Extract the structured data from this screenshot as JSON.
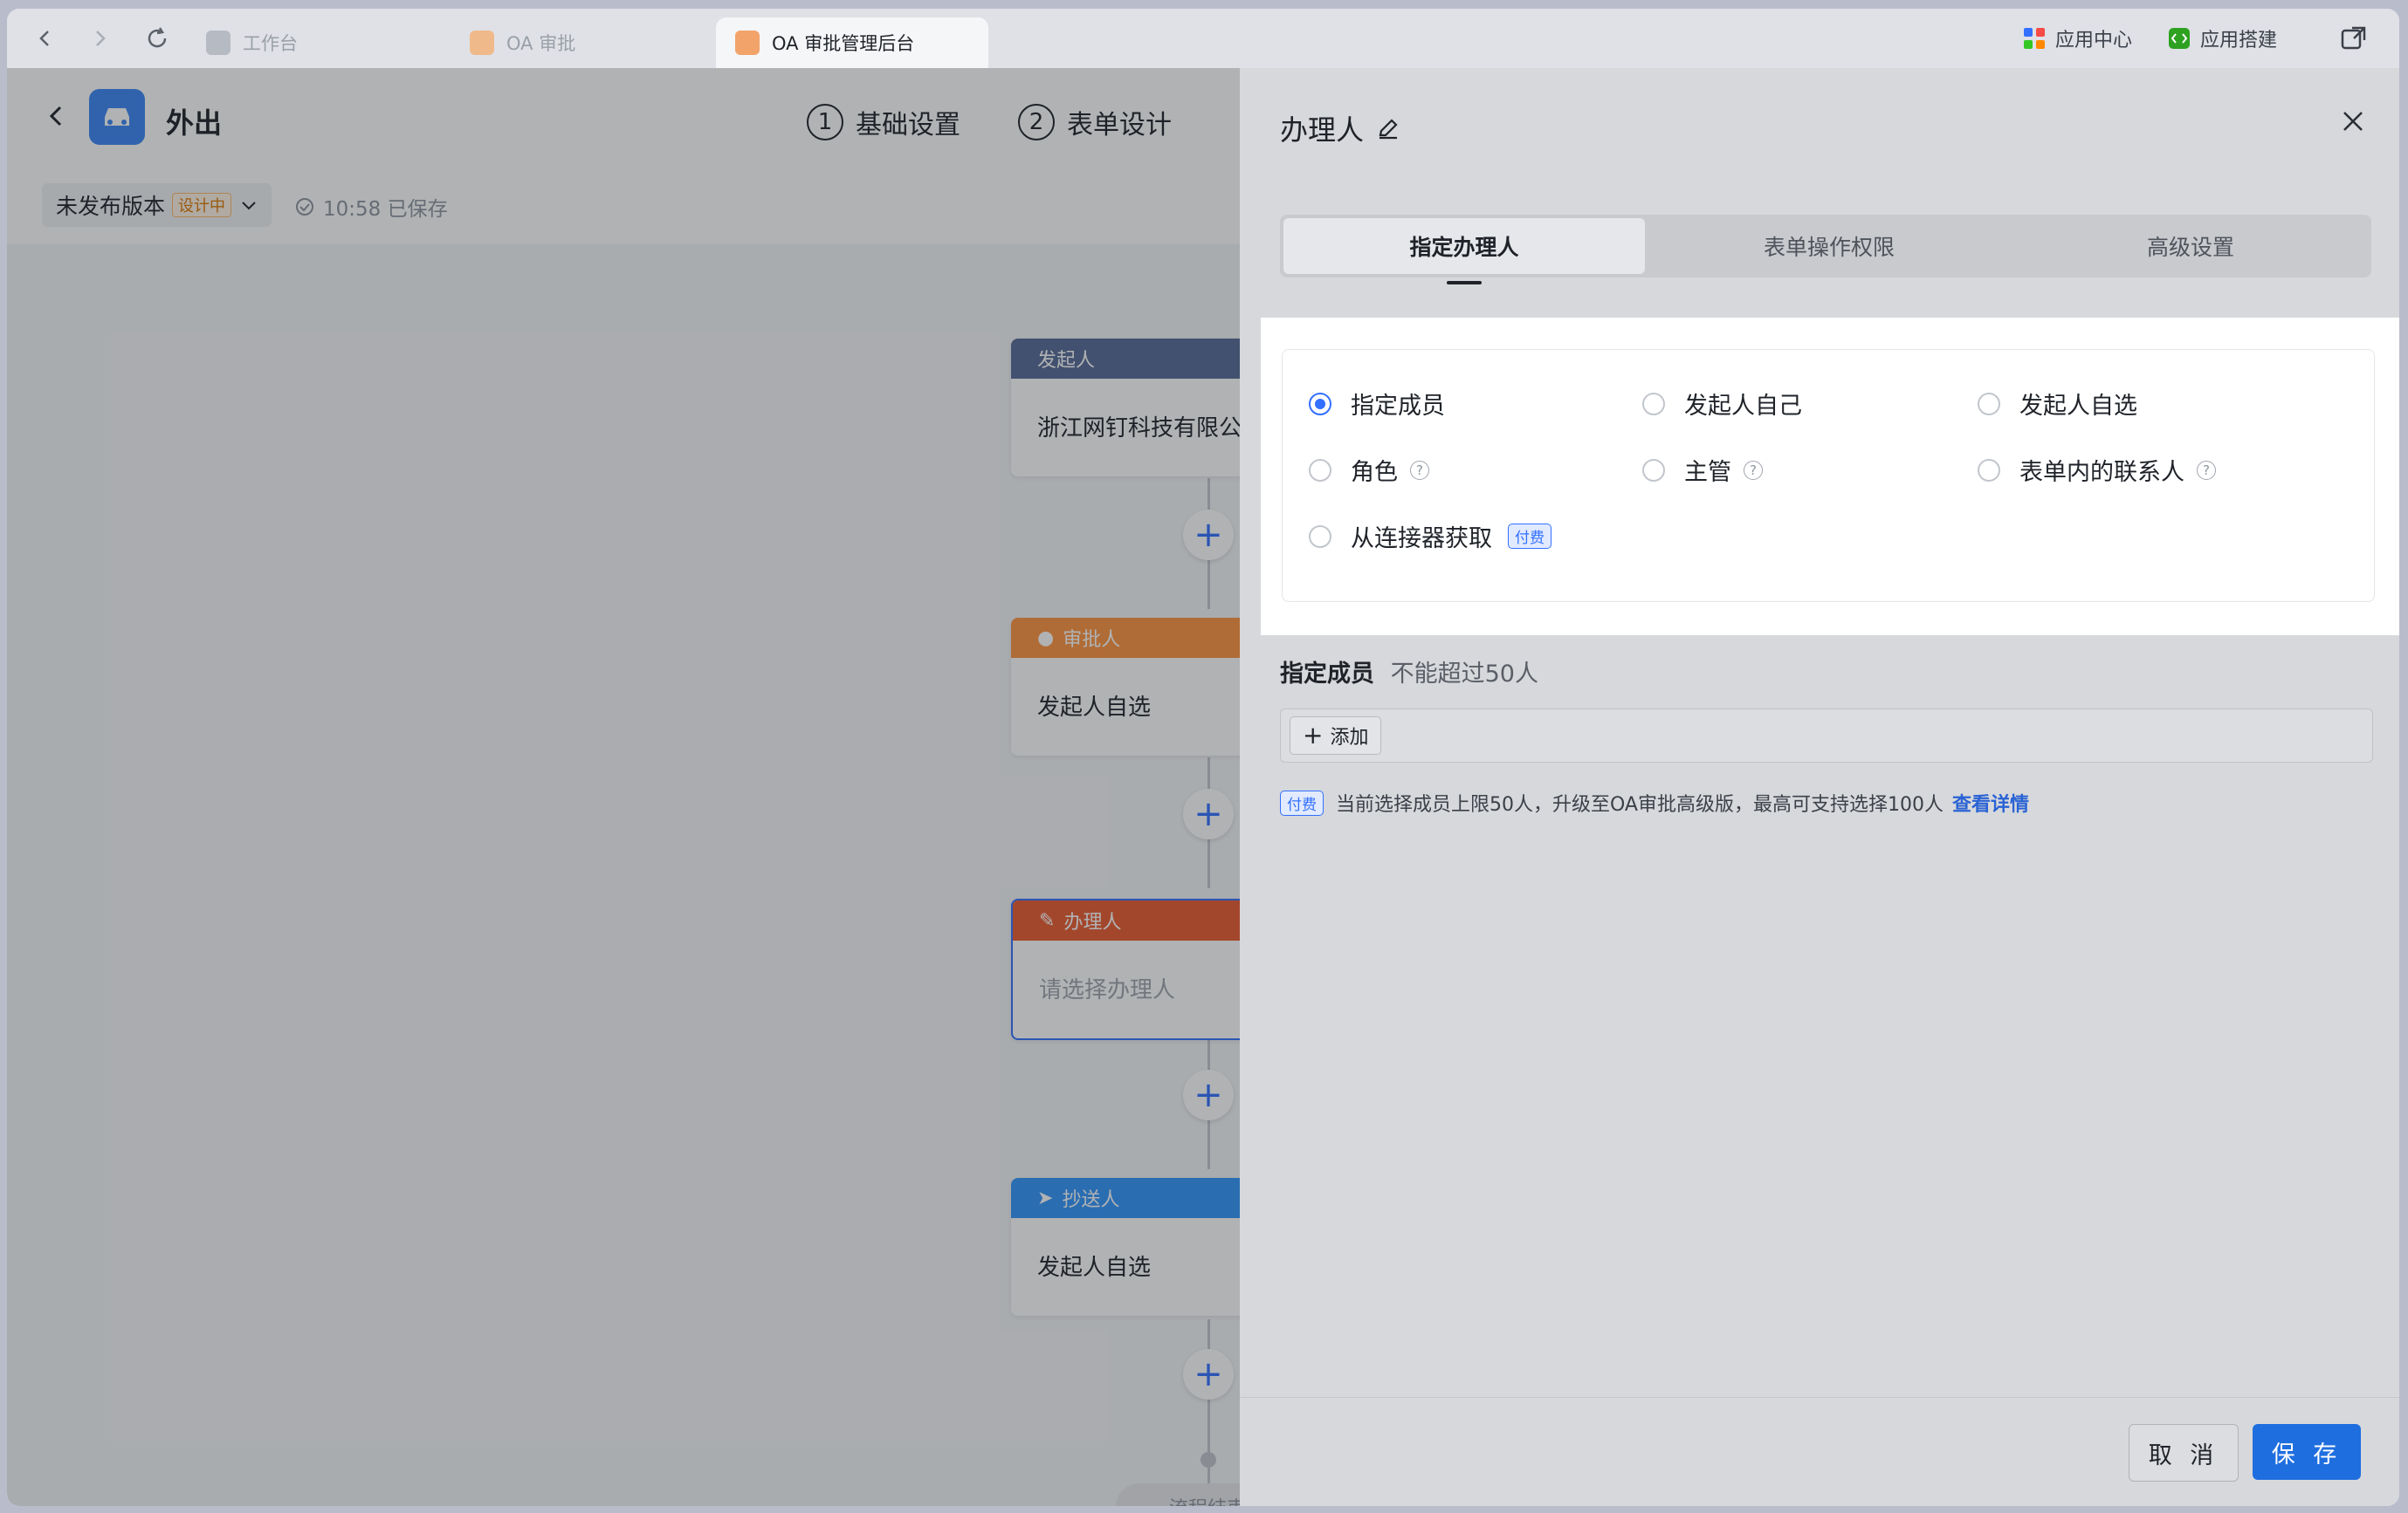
{
  "tabs": [
    {
      "label": "工作台",
      "icon": "workbench-icon"
    },
    {
      "label": "OA 审批",
      "icon": "oa-approval-icon"
    },
    {
      "label": "OA 审批管理后台",
      "icon": "oa-admin-icon"
    }
  ],
  "top_right": {
    "app_center": "应用中心",
    "app_build": "应用搭建"
  },
  "header": {
    "title": "外出",
    "steps": [
      {
        "num": "1",
        "label": "基础设置"
      },
      {
        "num": "2",
        "label": "表单设计"
      }
    ],
    "version": "未发布版本",
    "version_badge": "设计中",
    "saved": "10:58 已保存"
  },
  "flow": {
    "nodes": [
      {
        "type": "发起人",
        "content": "浙江网钉科技有限公",
        "color": "#576a95"
      },
      {
        "type": "审批人",
        "content": "发起人自选",
        "color": "#ff943e"
      },
      {
        "type": "办理人",
        "content": "请选择办理人",
        "color": "#ec5b2f"
      },
      {
        "type": "抄送人",
        "content": "发起人自选",
        "color": "#3296fa"
      }
    ],
    "end": "流程结束"
  },
  "panel": {
    "title": "办理人",
    "tabs": [
      "指定办理人",
      "表单操作权限",
      "高级设置"
    ],
    "options": [
      {
        "label": "指定成员",
        "selected": true
      },
      {
        "label": "发起人自己",
        "selected": false
      },
      {
        "label": "发起人自选",
        "selected": false
      },
      {
        "label": "角色",
        "selected": false,
        "help": "?"
      },
      {
        "label": "主管",
        "selected": false,
        "help": "?"
      },
      {
        "label": "表单内的联系人",
        "selected": false,
        "help": "?"
      },
      {
        "label": "从连接器获取",
        "selected": false,
        "badge": "付费"
      }
    ],
    "member_label": "指定成员",
    "member_limit": "不能超过50人",
    "add_label": "添加",
    "note_badge": "付费",
    "note_text": "当前选择成员上限50人，升级至OA审批高级版，最高可支持选择100人",
    "note_link": "查看详情",
    "cancel": "取 消",
    "save": "保 存"
  }
}
